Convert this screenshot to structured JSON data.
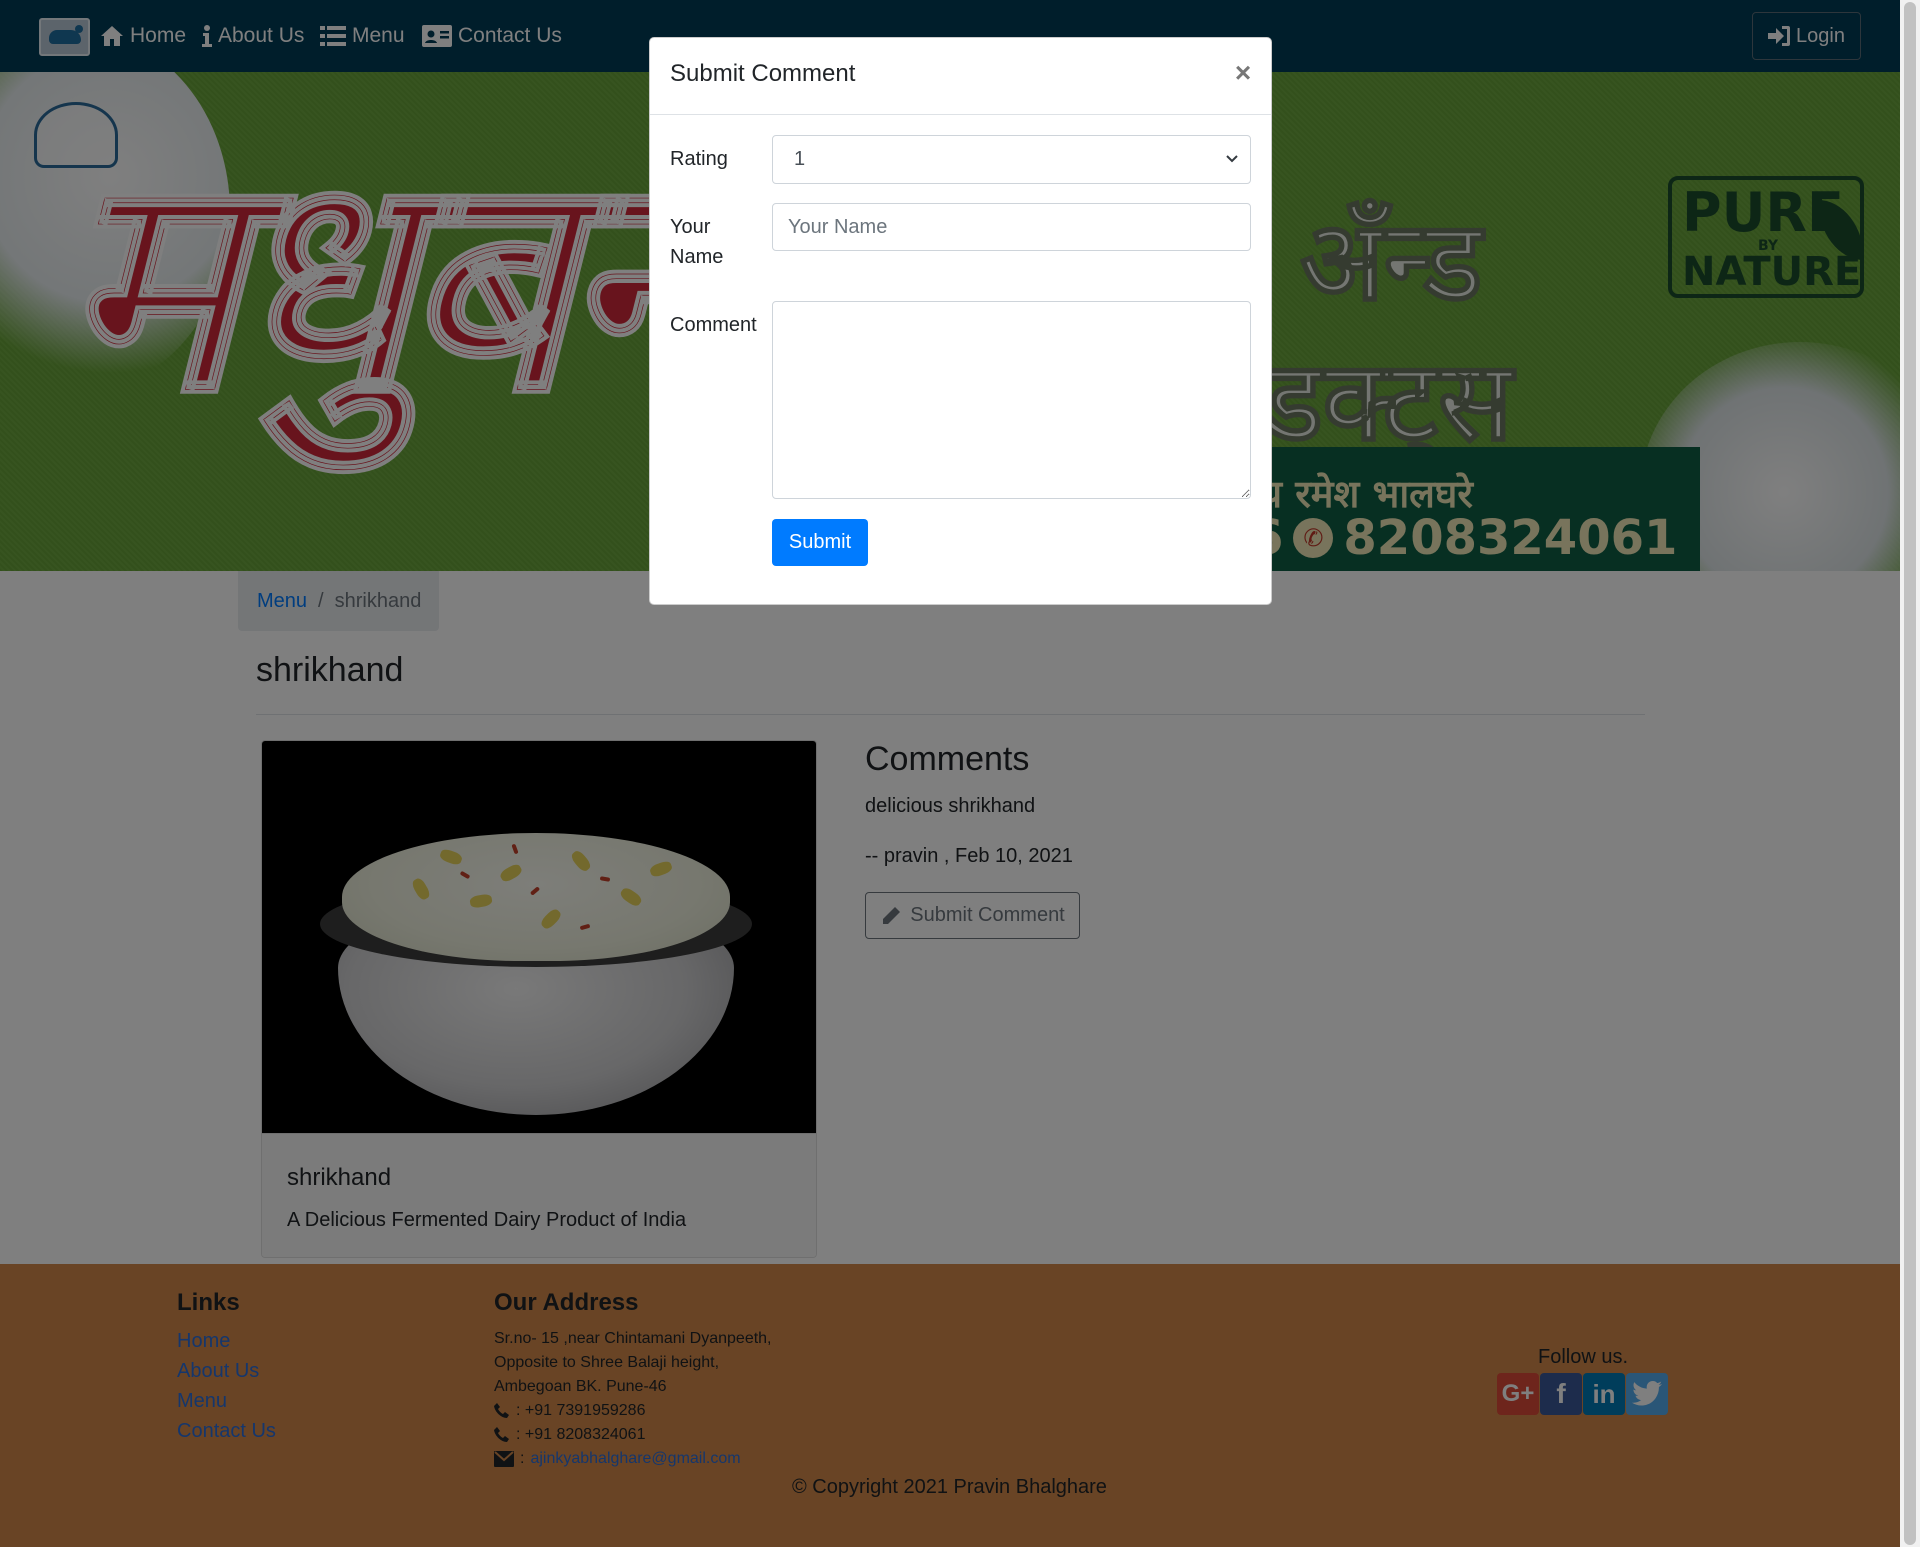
{
  "navbar": {
    "items": [
      {
        "label": "Home",
        "icon": "home-icon"
      },
      {
        "label": "About Us",
        "icon": "info-icon"
      },
      {
        "label": "Menu",
        "icon": "list-icon"
      },
      {
        "label": "Contact Us",
        "icon": "address-card-icon"
      }
    ],
    "login_label": "Login",
    "background": "#013c57"
  },
  "banner": {
    "brand_text": "मधुबन",
    "headline_1": "अँन्ड",
    "headline_2": "ॉडक्ट्स",
    "subline": "य रमेश भालघरे",
    "phone_prefix": "6",
    "phone": "8208324061",
    "badge_line1": "PURE",
    "badge_line2": "BY",
    "badge_line3": "NATURE"
  },
  "breadcrumb": {
    "parent": "Menu",
    "separator": "/",
    "current": "shrikhand"
  },
  "page_title": "shrikhand",
  "dish_card": {
    "name": "shrikhand",
    "description": "A Delicious Fermented Dairy Product of India"
  },
  "comments": {
    "heading": "Comments",
    "items": [
      {
        "text": "delicious shrikhand",
        "meta": "-- pravin , Feb 10, 2021"
      }
    ],
    "open_button_label": "Submit Comment"
  },
  "footer": {
    "links_heading": "Links",
    "links": [
      "Home",
      "About Us",
      "Menu",
      "Contact Us"
    ],
    "address_heading": "Our Address",
    "address_lines": [
      "Sr.no- 15 ,near Chintamani Dyanpeeth,",
      "Opposite to Shree Balaji height,",
      "Ambegoan BK. Pune-46"
    ],
    "phones": [
      ": +91 7391959286",
      ": +91 8208324061"
    ],
    "email": "ajinkyabhalghare@gmail.com",
    "follow_label": "Follow us.",
    "social": [
      {
        "name": "google-plus",
        "glyph": "G+",
        "color": "#dd4b39"
      },
      {
        "name": "facebook",
        "glyph": "f",
        "color": "#3b5998"
      },
      {
        "name": "linkedin",
        "glyph": "in",
        "color": "#007bb6"
      },
      {
        "name": "twitter",
        "glyph": "🐦",
        "color": "#55acee"
      }
    ],
    "copyright": "© Copyright 2021 Pravin Bhalghare",
    "background": "#d2894a"
  },
  "modal": {
    "title": "Submit Comment",
    "close_glyph": "×",
    "rating_label": "Rating",
    "rating_value": "1",
    "name_label_line1": "Your",
    "name_label_line2": "Name",
    "name_placeholder": "Your Name",
    "comment_label": "Comment",
    "submit_label": "Submit",
    "accent": "#007bff"
  }
}
